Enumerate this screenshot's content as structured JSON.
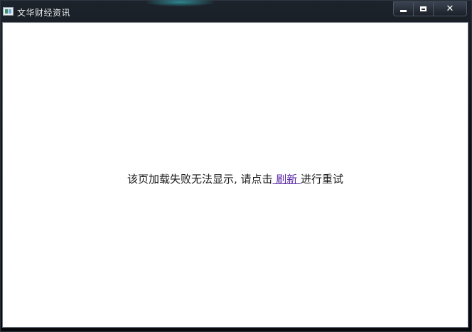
{
  "window": {
    "title": "文华财经资讯",
    "controls": {
      "minimize": "minimize-icon",
      "maximize": "maximize-icon",
      "close": "close-icon"
    }
  },
  "content": {
    "message_prefix": "该页加载失败无法显示, 请点击",
    "refresh_link": " 刷新 ",
    "message_suffix": "进行重试"
  },
  "colors": {
    "link": "#5a2aa8",
    "client_bg": "#ffffff",
    "frame_bg": "#0e1116"
  }
}
